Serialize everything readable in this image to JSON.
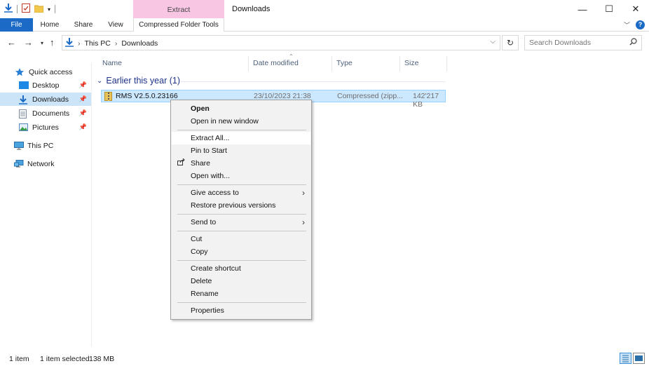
{
  "window": {
    "title": "Downloads",
    "context_tab_group": "Extract",
    "minimize_glyph": "—",
    "maximize_glyph": "☐",
    "close_glyph": "✕"
  },
  "ribbon": {
    "tabs": [
      "File",
      "Home",
      "Share",
      "View",
      "Compressed Folder Tools"
    ],
    "help_glyph": "?"
  },
  "address": {
    "crumbs": [
      "This PC",
      "Downloads"
    ],
    "search_placeholder": "Search Downloads"
  },
  "sidebar": {
    "items": [
      {
        "label": "Quick access",
        "icon": "star-icon"
      },
      {
        "label": "Desktop",
        "icon": "desktop-icon",
        "pinned": true
      },
      {
        "label": "Downloads",
        "icon": "download-icon",
        "pinned": true,
        "selected": true
      },
      {
        "label": "Documents",
        "icon": "documents-icon",
        "pinned": true
      },
      {
        "label": "Pictures",
        "icon": "pictures-icon",
        "pinned": true
      },
      {
        "label": "This PC",
        "icon": "computer-icon"
      },
      {
        "label": "Network",
        "icon": "network-icon"
      }
    ]
  },
  "columns": [
    "Name",
    "Date modified",
    "Type",
    "Size"
  ],
  "group": {
    "label": "Earlier this year (1)"
  },
  "file": {
    "name": "RMS V2.5.0.23166",
    "date": "23/10/2023 21:38",
    "type": "Compressed (zipp...",
    "size": "142'217 KB"
  },
  "context_menu": {
    "items": [
      "Open",
      "Open in new window",
      "Extract All...",
      "Pin to Start",
      "Share",
      "Open with...",
      "Give access to",
      "Restore previous versions",
      "Send to",
      "Cut",
      "Copy",
      "Create shortcut",
      "Delete",
      "Rename",
      "Properties"
    ]
  },
  "status": {
    "count": "1 item",
    "selected": "1 item selected",
    "size": "138 MB"
  },
  "colors": {
    "accent": "#1a6ac6",
    "context_tab": "#f8c6e3",
    "selection": "#cce8ff"
  }
}
